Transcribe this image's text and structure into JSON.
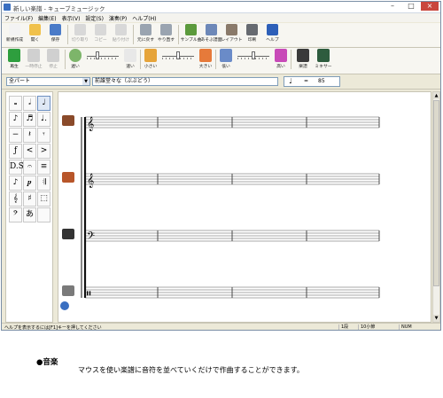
{
  "window": {
    "title": "新しい楽譜 - キューブミュージック",
    "controls": {
      "minimize": "–",
      "maximize": "□",
      "close": "×"
    }
  },
  "menu": [
    "ファイル(F)",
    "編集(E)",
    "表示(V)",
    "設定(S)",
    "演奏(P)",
    "ヘルプ(H)"
  ],
  "toolbar": [
    {
      "label": "新規作成",
      "icon": "new-file-icon",
      "color": "#f3f3f3",
      "enabled": true
    },
    {
      "label": "開く",
      "icon": "open-folder-icon",
      "color": "#f0c14b",
      "enabled": true
    },
    {
      "label": "保存",
      "icon": "save-icon",
      "color": "#4a7bc8",
      "enabled": true
    },
    {
      "label": "切り取り",
      "icon": "cut-icon",
      "color": "#d8d8d8",
      "enabled": false
    },
    {
      "label": "コピー",
      "icon": "copy-icon",
      "color": "#d8d8d8",
      "enabled": false
    },
    {
      "label": "貼り付け",
      "icon": "paste-icon",
      "color": "#d8d8d8",
      "enabled": false
    },
    {
      "label": "元に戻す",
      "icon": "undo-icon",
      "color": "#9aa4b0",
      "enabled": true
    },
    {
      "label": "やり直す",
      "icon": "redo-icon",
      "color": "#9aa4b0",
      "enabled": true
    },
    {
      "label": "サンプル曲",
      "icon": "sample-icon",
      "color": "#5b9a3c",
      "enabled": true
    },
    {
      "label": "あそぶ譜面",
      "icon": "score-view-icon",
      "color": "#6d88b8",
      "enabled": true
    },
    {
      "label": "レイアウト",
      "icon": "layout-icon",
      "color": "#8a7a6a",
      "enabled": true
    },
    {
      "label": "印刷",
      "icon": "print-icon",
      "color": "#666a70",
      "enabled": true
    },
    {
      "label": "ヘルプ",
      "icon": "help-icon",
      "color": "#2d5fb8",
      "enabled": true
    }
  ],
  "transport": {
    "play": {
      "label": "再生",
      "icon": "play-icon",
      "color": "#2e9e3e"
    },
    "pause": {
      "label": "一時停止",
      "icon": "pause-icon",
      "color": "#a8a8a8"
    },
    "stop": {
      "label": "停止",
      "icon": "stop-icon",
      "color": "#a8a8a8"
    },
    "slow": {
      "label": "遅い",
      "icon": "slow-turtle-icon"
    },
    "fast": {
      "label": "速い",
      "icon": "fast-rabbit-icon"
    },
    "quiet": {
      "label": "小さい",
      "icon": "quiet-speaker-icon"
    },
    "loud": {
      "label": "大きい",
      "icon": "loud-speaker-icon"
    },
    "low": {
      "label": "低い",
      "icon": "low-pitch-icon"
    },
    "high": {
      "label": "高い",
      "icon": "high-pitch-icon"
    },
    "score": {
      "label": "楽譜",
      "icon": "score-icon"
    },
    "mixer": {
      "label": "ミキサー",
      "icon": "mixer-icon"
    },
    "speed_level": 0.3,
    "volume_level": 0.5,
    "pitch_level": 0.5
  },
  "part": {
    "selected": "全パート",
    "name": "前誰堂々な（ぶぶどう）",
    "tempo_value": "85",
    "tempo_equals": "="
  },
  "palette": [
    "𝅝",
    "𝅗𝅥",
    "♩",
    "♪",
    "♬",
    "♩.",
    "−",
    "𝄽",
    "𝄾",
    "ƒ",
    "<",
    ">",
    "D.S.",
    "𝄐",
    "≡",
    "♪",
    "𝆏",
    "𝄇",
    "𝄞",
    "♯",
    "⬚",
    "𝄢",
    "あ",
    ""
  ],
  "staves": [
    {
      "icon": "guitar-icon",
      "clef": "𝄞"
    },
    {
      "icon": "drum-kit-icon",
      "clef": "𝄞"
    },
    {
      "icon": "piano-icon",
      "clef": "𝄢"
    },
    {
      "icon": "snare-drum-icon",
      "clef": "𝄥"
    }
  ],
  "status": {
    "message": "ヘルプを表示するには[F1]キーを押してください",
    "part_no": "1段",
    "measure": "10小節",
    "num": "NUM"
  },
  "caption": {
    "title": "●音楽",
    "text": "マウスを使い楽譜に音符を並べていくだけで作曲することができます。"
  }
}
